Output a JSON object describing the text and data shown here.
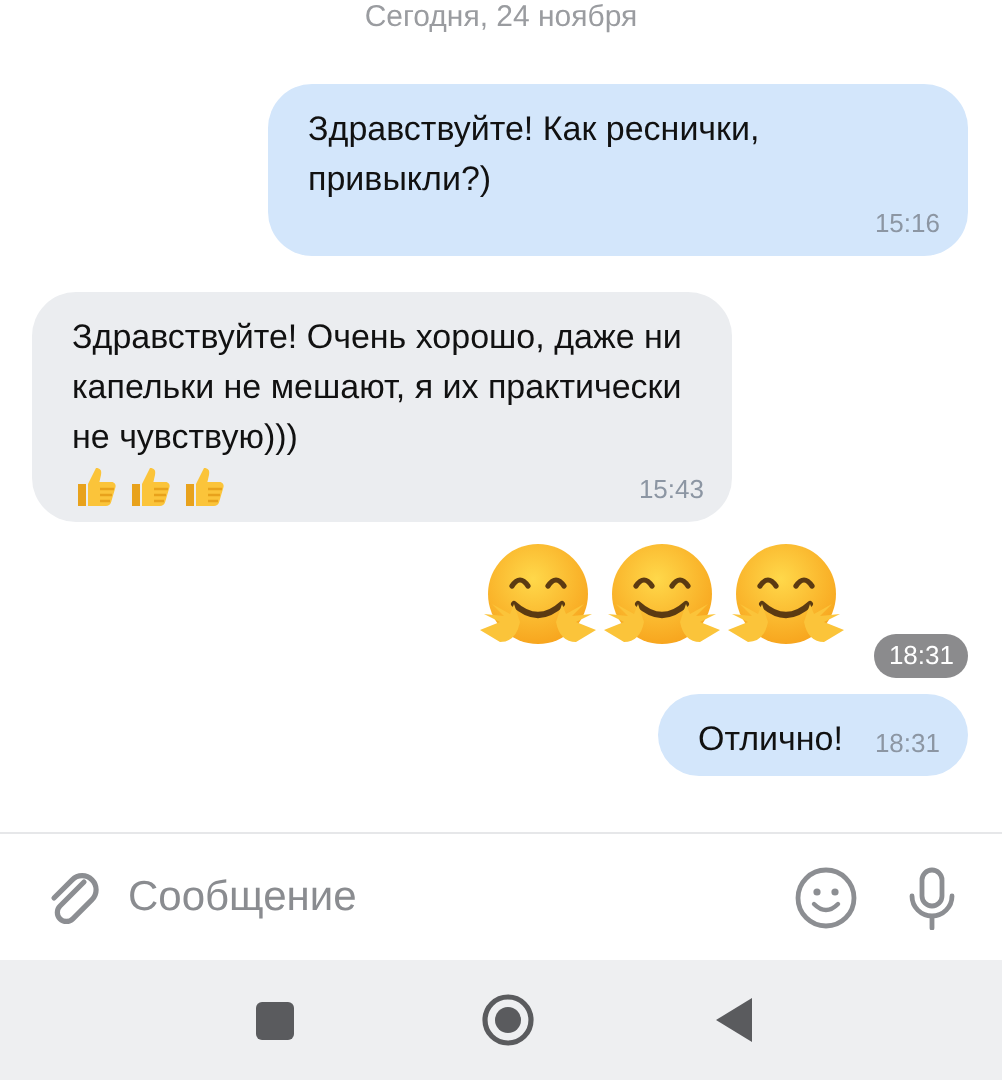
{
  "date_separator": "Сегодня, 24 ноября",
  "messages": [
    {
      "kind": "text",
      "outgoing": true,
      "text": "Здравствуйте! Как реснички, привыкли?)",
      "time": "15:16"
    },
    {
      "kind": "text",
      "outgoing": false,
      "text": "Здравствуйте! Очень хорошо, даже ни капельки не мешают, я их практически не чувствую)))",
      "icons": [
        {
          "kind": "thumbs-up"
        },
        {
          "kind": "thumbs-up"
        },
        {
          "kind": "thumbs-up"
        }
      ],
      "time": "15:43"
    },
    {
      "kind": "emoji",
      "outgoing": true,
      "icons": [
        {
          "kind": "hug"
        },
        {
          "kind": "hug"
        },
        {
          "kind": "hug"
        }
      ],
      "time": "18:31"
    },
    {
      "kind": "text",
      "outgoing": true,
      "text": "Отлично!",
      "time": "18:31"
    }
  ],
  "composer": {
    "placeholder": "Сообщение"
  }
}
